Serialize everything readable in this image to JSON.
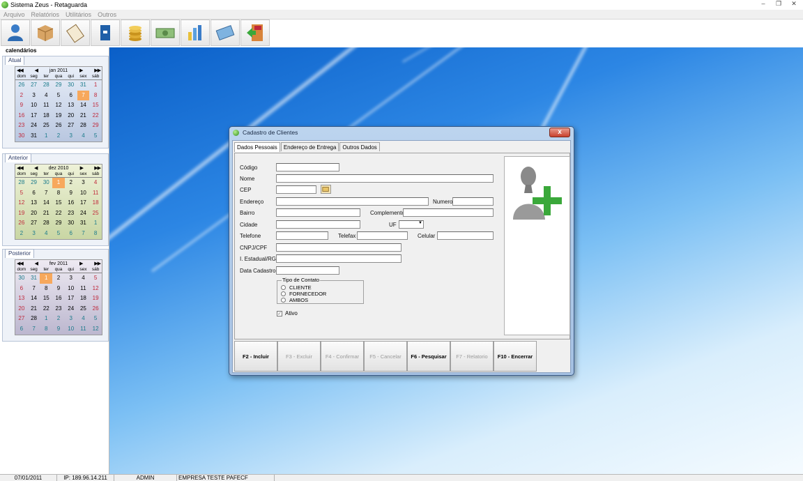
{
  "window": {
    "title": "Sistema Zeus - Retaguarda"
  },
  "menu": [
    "Arquivo",
    "Relatórios",
    "Utilitários",
    "Outros"
  ],
  "toolbar": [
    "users-icon",
    "box-icon",
    "clipboard-icon",
    "book-icon",
    "coins-icon",
    "banknote-icon",
    "bar-chart-icon",
    "cash-icon",
    "exit-icon"
  ],
  "left_panel": {
    "title": "calendários"
  },
  "calendars": [
    {
      "tab": "Atual",
      "month": "jan 2011",
      "weekdays": [
        "dom",
        "seg",
        "ter",
        "qua",
        "qui",
        "sex",
        "sáb"
      ],
      "days": [
        "26",
        "27",
        "28",
        "29",
        "30",
        "31",
        "1",
        "2",
        "3",
        "4",
        "5",
        "6",
        "7",
        "8",
        "9",
        "10",
        "11",
        "12",
        "13",
        "14",
        "15",
        "16",
        "17",
        "18",
        "19",
        "20",
        "21",
        "22",
        "23",
        "24",
        "25",
        "26",
        "27",
        "28",
        "29",
        "30",
        "31",
        "1",
        "2",
        "3",
        "4",
        "5"
      ],
      "highlight": "7"
    },
    {
      "tab": "Anterior",
      "month": "dez 2010",
      "weekdays": [
        "dom",
        "seg",
        "ter",
        "qua",
        "qui",
        "sex",
        "sáb"
      ],
      "days": [
        "28",
        "29",
        "30",
        "1",
        "2",
        "3",
        "4",
        "5",
        "6",
        "7",
        "8",
        "9",
        "10",
        "11",
        "12",
        "13",
        "14",
        "15",
        "16",
        "17",
        "18",
        "19",
        "20",
        "21",
        "22",
        "23",
        "24",
        "25",
        "26",
        "27",
        "28",
        "29",
        "30",
        "31",
        "1",
        "2",
        "3",
        "4",
        "5",
        "6",
        "7",
        "8"
      ],
      "highlight": "1"
    },
    {
      "tab": "Posterior",
      "month": "fev 2011",
      "weekdays": [
        "dom",
        "seg",
        "ter",
        "qua",
        "qui",
        "sex",
        "sáb"
      ],
      "days": [
        "30",
        "31",
        "1",
        "2",
        "3",
        "4",
        "5",
        "6",
        "7",
        "8",
        "9",
        "10",
        "11",
        "12",
        "13",
        "14",
        "15",
        "16",
        "17",
        "18",
        "19",
        "20",
        "21",
        "22",
        "23",
        "24",
        "25",
        "26",
        "27",
        "28",
        "1",
        "2",
        "3",
        "4",
        "5",
        "6",
        "7",
        "8",
        "9",
        "10",
        "11",
        "12"
      ],
      "highlight": "1"
    }
  ],
  "dialog": {
    "title": "Cadastro de Clientes",
    "close": "x",
    "tabs": [
      "Dados Pessoais",
      "Endereço de Entrega",
      "Outros Dados"
    ],
    "labels": {
      "codigo": "Código",
      "nome": "Nome",
      "cep": "CEP",
      "endereco": "Endereço",
      "numero": "Numero",
      "bairro": "Bairro",
      "complemento": "Complemento",
      "cidade": "Cidade",
      "uf": "UF",
      "telefone": "Telefone",
      "telefax": "Telefax",
      "celular": "Celular",
      "cnpj": "CNPJ/CPF",
      "ie": "I. Estadual/RG",
      "data_cadastro": "Data Cadastro"
    },
    "tipo_contato": {
      "label": "Tipo de Contato",
      "options": [
        "CLIENTE",
        "FORNECEDOR",
        "AMBOS"
      ]
    },
    "ativo": {
      "label": "Ativo",
      "checked": true
    },
    "buttons": [
      {
        "label": "F2 - Incluir",
        "enabled": true
      },
      {
        "label": "F3 - Excluir",
        "enabled": false
      },
      {
        "label": "F4 - Confirmar",
        "enabled": false
      },
      {
        "label": "F5 - Cancelar",
        "enabled": false
      },
      {
        "label": "F6 - Pesquisar",
        "enabled": true
      },
      {
        "label": "F7 - Relatorio",
        "enabled": false
      },
      {
        "label": "F10 - Encerrar",
        "enabled": true
      }
    ]
  },
  "status": {
    "date": "07/01/2011",
    "ip": "IP: 189.96.14.211",
    "user": "ADMIN",
    "company": "EMPRESA TESTE PAFECF"
  }
}
